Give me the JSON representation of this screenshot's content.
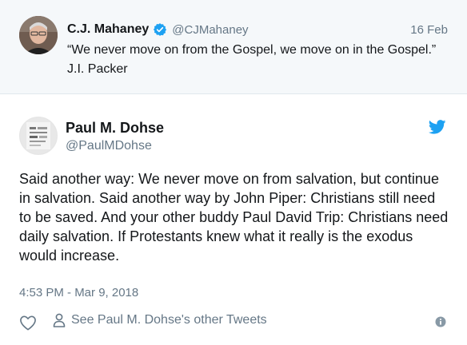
{
  "quoted_tweet": {
    "author_name": "C.J. Mahaney",
    "handle": "@CJMahaney",
    "date": "16 Feb",
    "text": "“We never move on from the Gospel, we move on in the Gospel.” J.I. Packer",
    "verified": true,
    "avatar_icon": "profile-photo"
  },
  "tweet": {
    "author_name": "Paul M. Dohse",
    "handle": "@PaulMDohse",
    "text": "Said another way: We never move on from salvation, but continue in salvation. Said another way by John Piper: Christians still need to be saved. And your other buddy Paul David Trip: Christians need daily salvation. If Protestants knew what it really is the exodus would increase.",
    "timestamp": "4:53 PM - Mar 9, 2018",
    "avatar_icon": "profile-photo",
    "brand_icon": "twitter-bird-icon"
  },
  "actions": {
    "like_icon": "heart-icon",
    "other_tweets_label": "See Paul M. Dohse's other Tweets",
    "person_icon": "person-icon",
    "info_icon": "info-icon"
  },
  "colors": {
    "quoted_background": "#f5f8fa",
    "text": "#14171a",
    "secondary_text": "#657786",
    "twitter_blue": "#1da1f2",
    "divider": "#e1e8ed"
  }
}
